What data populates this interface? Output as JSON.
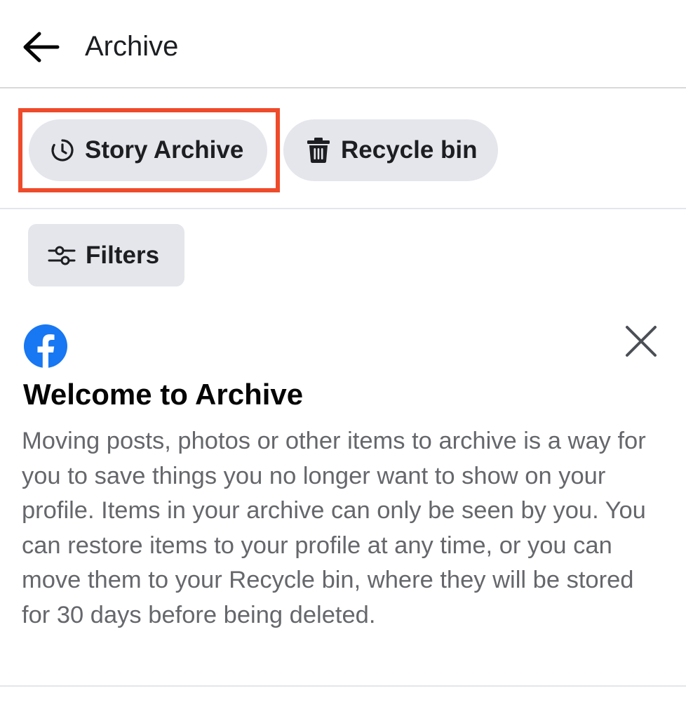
{
  "header": {
    "back_icon": "arrow-left-icon",
    "title": "Archive"
  },
  "tabs": {
    "story_archive": {
      "label": "Story Archive",
      "icon": "clock-history-icon"
    },
    "recycle_bin": {
      "label": "Recycle bin",
      "icon": "trash-icon"
    }
  },
  "filters": {
    "label": "Filters",
    "icon": "sliders-icon"
  },
  "welcome_card": {
    "logo": "facebook-logo",
    "close_icon": "close-icon",
    "title": "Welcome to Archive",
    "body": "Moving posts, photos or other items to archive is a way for you to save things you no longer want to show on your profile. Items in your archive can only be seen by you. You can restore items to your profile at any time, or you can move them to your Recycle bin, where they will be stored for 30 days before being deleted."
  },
  "colors": {
    "highlight": "#ee4b2b",
    "pill_bg": "#e4e6eb",
    "facebook_blue": "#1877f2",
    "body_text": "#65676b"
  }
}
